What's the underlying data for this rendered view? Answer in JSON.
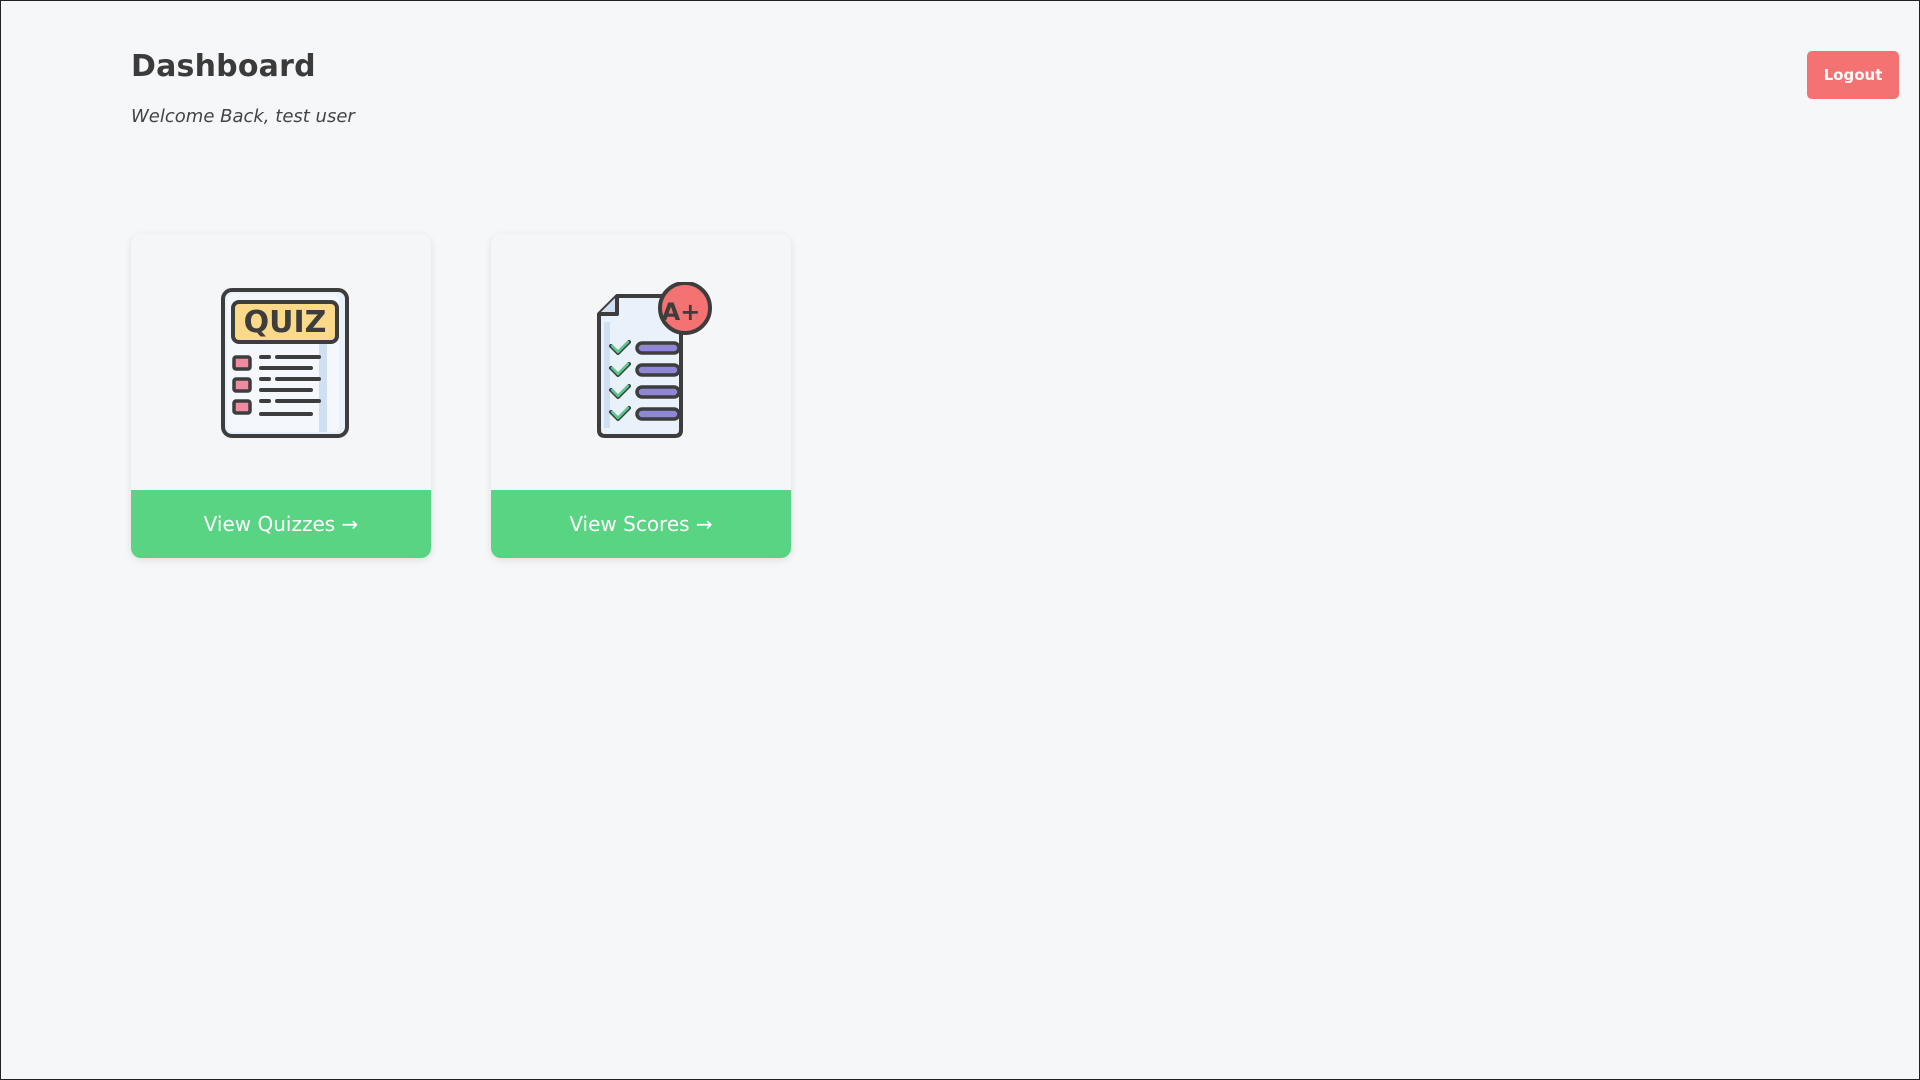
{
  "header": {
    "title": "Dashboard",
    "welcome": "Welcome Back, test user"
  },
  "actions": {
    "logout_label": "Logout"
  },
  "cards": [
    {
      "label": "View Quizzes →",
      "icon": "quiz-document-icon",
      "icon_text": "QUIZ"
    },
    {
      "label": "View Scores →",
      "icon": "graded-checklist-icon",
      "icon_text": "A+"
    }
  ],
  "colors": {
    "background": "#f6f7f9",
    "accent_green": "#58d483",
    "logout_red": "#f47272",
    "text_dark": "#3b3b3b"
  }
}
